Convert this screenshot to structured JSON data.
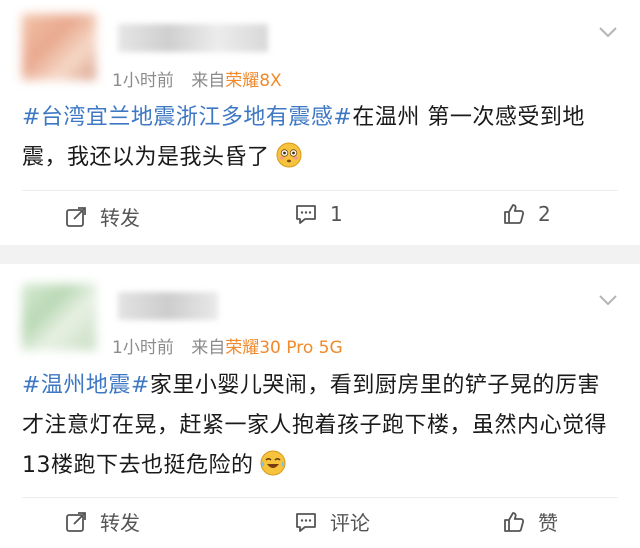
{
  "posts": [
    {
      "time": "1小时前",
      "source_prefix": "来自",
      "device": "荣耀8X",
      "hashtag": "#台湾宜兰地震浙江多地有震感#",
      "text": "在温州 第一次感受到地震，我还以为是我头昏了",
      "emoji": "flushed-face",
      "actions": {
        "repost": "转发",
        "comment": "1",
        "like": "2"
      }
    },
    {
      "time": "1小时前",
      "source_prefix": "来自",
      "device": "荣耀30 Pro 5G",
      "hashtag": "#温州地震#",
      "text": "家里小婴儿哭闹，看到厨房里的铲子晃的厉害才注意灯在晃，赶紧一家人抱着孩子跑下楼，虽然内心觉得13楼跑下去也挺危险的",
      "emoji": "tears-of-joy-face",
      "actions": {
        "repost": "转发",
        "comment": "评论",
        "like": "赞"
      }
    }
  ],
  "colors": {
    "hashtag": "#3e78c4",
    "device": "#f08a2c",
    "meta": "#8c8c8c",
    "separator": "#f2f2f2"
  }
}
